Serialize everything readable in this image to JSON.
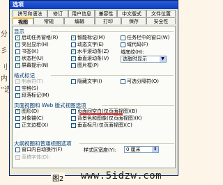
{
  "background_fragments": [
    "分",
    "彡",
    "刂",
    "内",
    "“选"
  ],
  "dialog": {
    "title": "选项",
    "tabs_row1": [
      "拼写和语法",
      "修订",
      "用户信息",
      "兼容性",
      "中文版式",
      "文件位置"
    ],
    "tabs_row2": [
      "视图",
      "常规",
      "编辑",
      "打印",
      "保存",
      "安全性"
    ],
    "active_tab": "视图",
    "sections": {
      "display": {
        "title": "显示",
        "items": [
          {
            "label": "启动任务窗格(R)",
            "checked": true
          },
          {
            "label": "智能标记(M)",
            "checked": true
          },
          {
            "label": "任务栏中的窗口(W)",
            "checked": false
          },
          {
            "label": "突出显示(H)",
            "checked": true
          },
          {
            "label": "动态文字(E)",
            "checked": false
          },
          {
            "label": "域代码(F)",
            "checked": false
          },
          {
            "label": "书签(K)",
            "checked": false
          },
          {
            "label": "水平滚动条(Z)",
            "checked": true
          },
          {
            "label": "状态栏(U)",
            "checked": true
          },
          {
            "label": "垂直滚动条(V)",
            "checked": true
          },
          {
            "label": "屏幕提示(N)",
            "checked": true
          },
          {
            "label": "图片框(P)",
            "checked": false
          }
        ],
        "field_shading_label": "域底纹(H):",
        "field_shading_value": "选取时显示"
      },
      "formatting_marks": {
        "title": "格式标记",
        "items": [
          {
            "label": "制表符(T)",
            "checked": false,
            "disabled": true
          },
          {
            "label": "隐藏文字(I)",
            "checked": false
          },
          {
            "label": "可选分隔符(O)",
            "checked": false
          },
          {
            "label": "空格(S)",
            "checked": false
          },
          {
            "label": "段落标记(M)",
            "checked": true
          }
        ]
      },
      "print_web_layout": {
        "title": "页面视图和 Web 版式视图选项",
        "items": [
          {
            "label": "图形(D)",
            "checked": true
          },
          {
            "label": "页面间空白(仅页面视图)(B)",
            "checked": true
          },
          {
            "label": "对象锚(C)",
            "checked": false
          },
          {
            "label": "背景色和图像(仅页面视图)(K)",
            "checked": false
          },
          {
            "label": "正文边框(X)",
            "checked": false
          },
          {
            "label": "垂直标尺(仅页面视图)(C)",
            "checked": true
          }
        ]
      },
      "outline_normal": {
        "title": "大纲视图和普通视图选项",
        "items": [
          {
            "label": "窗口内自动换行(F)",
            "checked": false
          },
          {
            "label": "草稿字体(D):",
            "checked": false,
            "disabled": true
          }
        ],
        "style_width_label": "样式区宽度(Y):",
        "style_width_value": "0 厘米"
      }
    }
  },
  "caption": "图2",
  "watermark": "www.5idzw.com",
  "colors": {
    "title_bar": "#0a3fbf",
    "check_mark": "#21a121",
    "highlight_underline": "#e02020"
  }
}
